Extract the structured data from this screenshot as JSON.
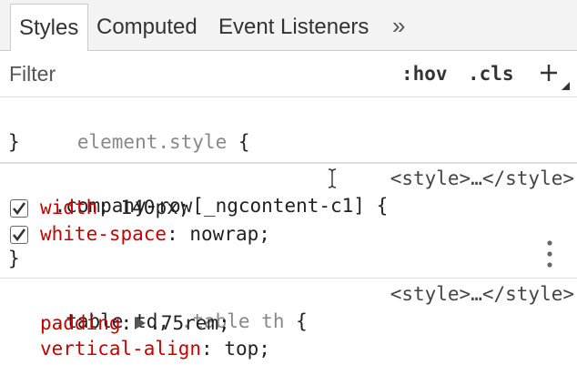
{
  "tabs": [
    {
      "label": "Styles",
      "active": true
    },
    {
      "label": "Computed",
      "active": false
    },
    {
      "label": "Event Listeners",
      "active": false
    }
  ],
  "tabs_overflow_label": "»",
  "toolbar": {
    "filter_placeholder": "Filter",
    "hov_label": ":hov",
    "cls_label": ".cls",
    "add_rule_label": "+",
    "add_rule_icon": "plus-icon"
  },
  "rules": {
    "element_style": {
      "selector": "element.style",
      "open_brace": "{",
      "close_brace": "}"
    },
    "company_row": {
      "selector": ".company-row[_ngcontent-c1]",
      "open_brace": "{",
      "source": "<style>…</style>",
      "declarations": [
        {
          "property": "width",
          "value": "140px",
          "checked": true
        },
        {
          "property": "white-space",
          "value": "nowrap",
          "checked": true
        }
      ],
      "close_brace": "}"
    },
    "table_td": {
      "selector_matched": ".table td,",
      "selector_unmatched": ".table th",
      "open_brace": "{",
      "source": "<style>…</style>",
      "declarations": [
        {
          "property": "padding",
          "value": ".75rem",
          "expandable": true
        },
        {
          "property": "vertical-align",
          "value": "top",
          "expandable": false
        }
      ]
    }
  },
  "colors": {
    "property": "#c80000",
    "value": "#222222",
    "unmatched_selector": "#888888",
    "tabbar_bg": "#f3f3f3",
    "divider": "#dddddd"
  }
}
